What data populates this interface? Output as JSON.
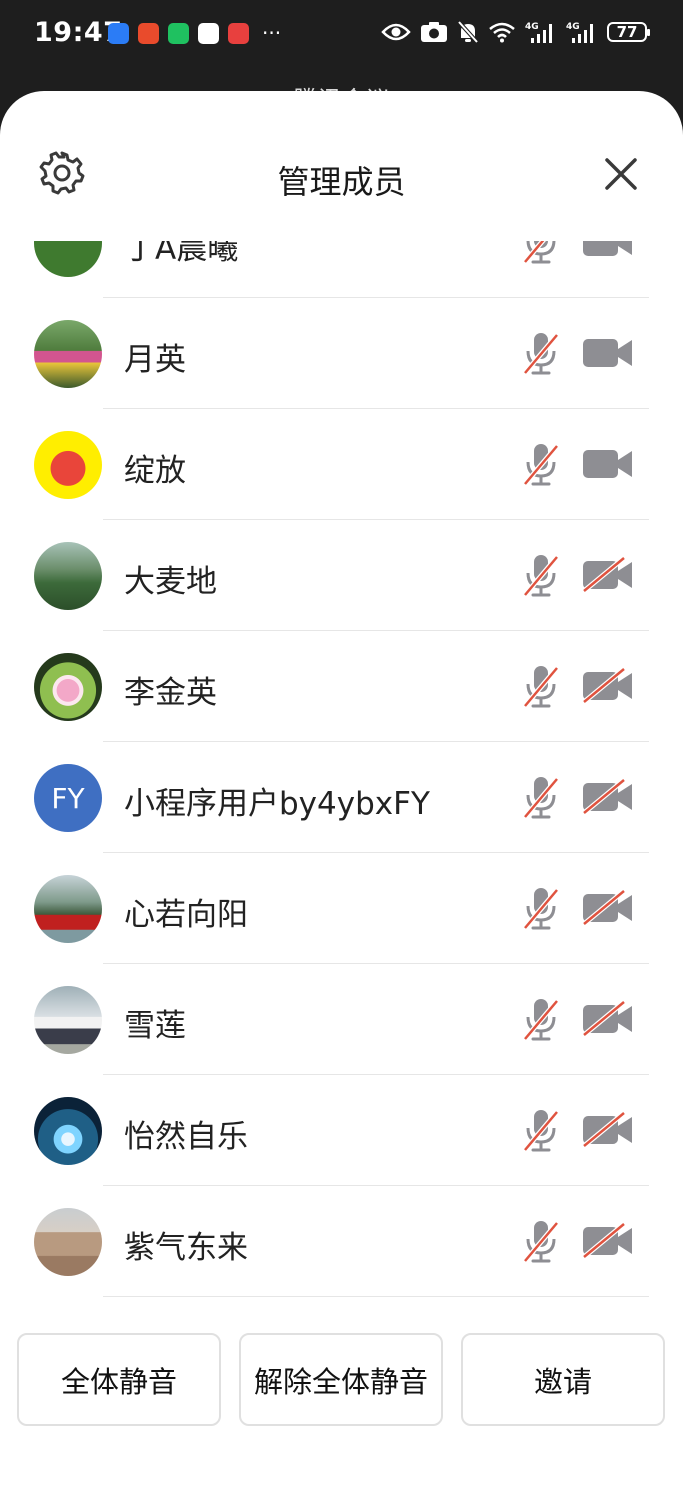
{
  "status_bar": {
    "time": "19:47",
    "more": "···",
    "battery": "77",
    "signal_1": "4G",
    "signal_2": "4G"
  },
  "background_app": {
    "title": "腾讯会议"
  },
  "sheet": {
    "title": "管理成员"
  },
  "members": [
    {
      "name": "丁A晨曦",
      "mic_muted": true,
      "camera_on": true
    },
    {
      "name": "月英",
      "mic_muted": true,
      "camera_on": true
    },
    {
      "name": "绽放",
      "mic_muted": true,
      "camera_on": true
    },
    {
      "name": "大麦地",
      "mic_muted": true,
      "camera_on": false
    },
    {
      "name": "李金英",
      "mic_muted": true,
      "camera_on": false
    },
    {
      "name": "小程序用户by4ybxFY",
      "initials": "FY",
      "mic_muted": true,
      "camera_on": false
    },
    {
      "name": "心若向阳",
      "mic_muted": true,
      "camera_on": false
    },
    {
      "name": "雪莲",
      "mic_muted": true,
      "camera_on": false
    },
    {
      "name": "怡然自乐",
      "mic_muted": true,
      "camera_on": false
    },
    {
      "name": "紫气东来",
      "mic_muted": true,
      "camera_on": false
    }
  ],
  "actions": {
    "mute_all": "全体静音",
    "unmute_all": "解除全体静音",
    "invite": "邀请"
  },
  "colors": {
    "icon_gray": "#8e8e93",
    "muted_red": "#e0533f",
    "avatar_blue": "#3f6fc2"
  }
}
